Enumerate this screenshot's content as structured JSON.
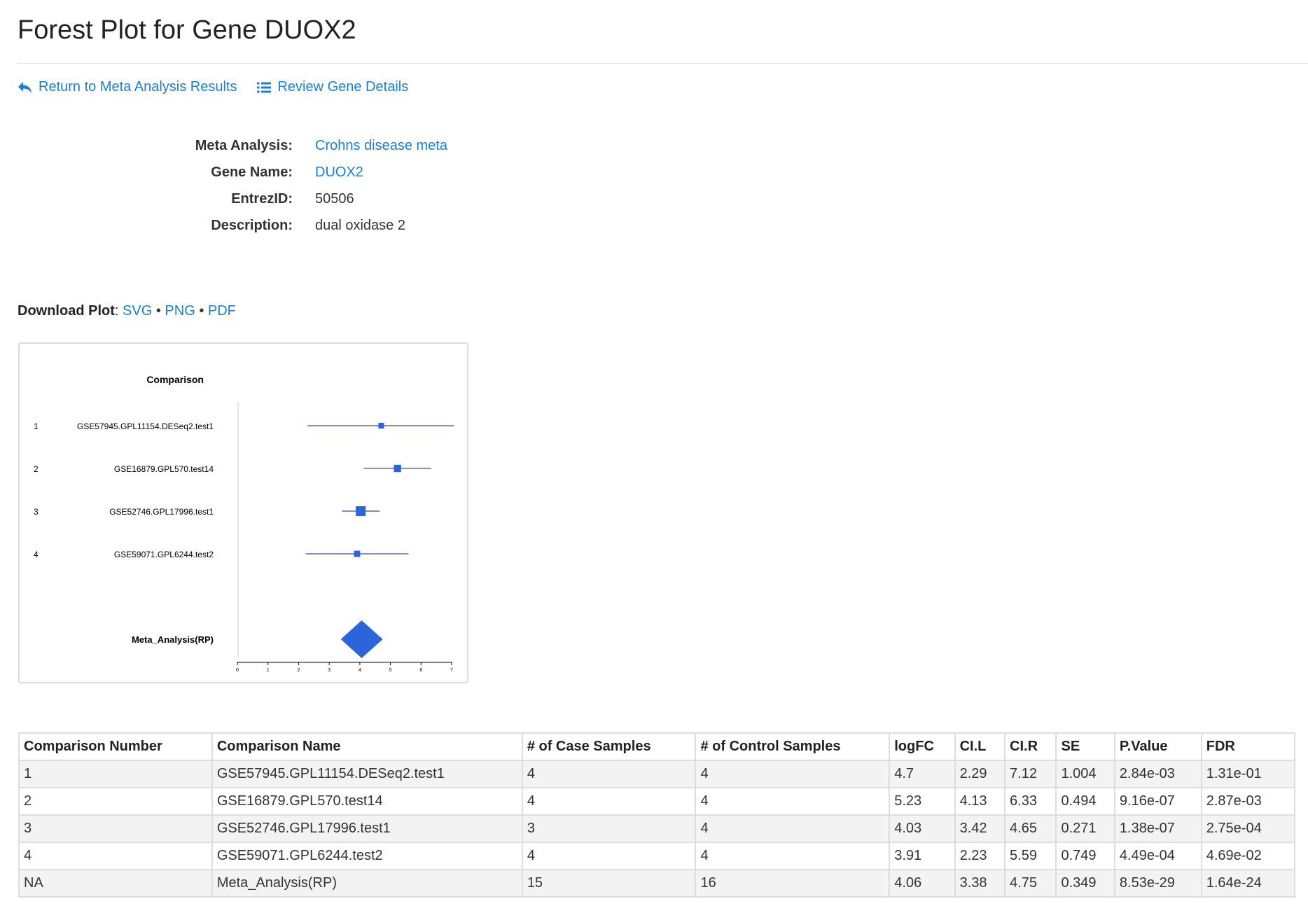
{
  "page": {
    "title": "Forest Plot for Gene DUOX2"
  },
  "nav": {
    "return_label": "Return to Meta Analysis Results",
    "review_label": "Review Gene Details"
  },
  "info": {
    "meta_analysis_label": "Meta Analysis:",
    "meta_analysis_value": "Crohns disease meta",
    "gene_name_label": "Gene Name:",
    "gene_name_value": "DUOX2",
    "entrez_label": "EntrezID:",
    "entrez_value": "50506",
    "description_label": "Description:",
    "description_value": "dual oxidase 2"
  },
  "download": {
    "label": "Download Plot",
    "colon": ":",
    "sep": "•",
    "svg": "SVG",
    "png": "PNG",
    "pdf": "PDF"
  },
  "chart_data": {
    "type": "forest",
    "header": "Comparison",
    "color": "#2b65d9",
    "line_color": "#3a4a9e",
    "xlim": [
      0,
      7
    ],
    "xticks": [
      "0",
      "1",
      "2",
      "3",
      "4",
      "5",
      "6",
      "7"
    ],
    "studies": [
      {
        "num": "1",
        "name": "GSE57945.GPL11154.DESeq2.test1",
        "est": 4.7,
        "lo": 2.29,
        "hi": 7.12,
        "se": 1.004
      },
      {
        "num": "2",
        "name": "GSE16879.GPL570.test14",
        "est": 5.23,
        "lo": 4.13,
        "hi": 6.33,
        "se": 0.494
      },
      {
        "num": "3",
        "name": "GSE52746.GPL17996.test1",
        "est": 4.03,
        "lo": 3.42,
        "hi": 4.65,
        "se": 0.271
      },
      {
        "num": "4",
        "name": "GSE59071.GPL6244.test2",
        "est": 3.91,
        "lo": 2.23,
        "hi": 5.59,
        "se": 0.749
      }
    ],
    "summary": {
      "name": "Meta_Analysis(RP)",
      "est": 4.06,
      "lo": 3.38,
      "hi": 4.75
    }
  },
  "table": {
    "headers": [
      "Comparison Number",
      "Comparison Name",
      "# of Case Samples",
      "# of Control Samples",
      "logFC",
      "CI.L",
      "CI.R",
      "SE",
      "P.Value",
      "FDR"
    ],
    "rows": [
      [
        "1",
        "GSE57945.GPL11154.DESeq2.test1",
        "4",
        "4",
        "4.7",
        "2.29",
        "7.12",
        "1.004",
        "2.84e-03",
        "1.31e-01"
      ],
      [
        "2",
        "GSE16879.GPL570.test14",
        "4",
        "4",
        "5.23",
        "4.13",
        "6.33",
        "0.494",
        "9.16e-07",
        "2.87e-03"
      ],
      [
        "3",
        "GSE52746.GPL17996.test1",
        "3",
        "4",
        "4.03",
        "3.42",
        "4.65",
        "0.271",
        "1.38e-07",
        "2.75e-04"
      ],
      [
        "4",
        "GSE59071.GPL6244.test2",
        "4",
        "4",
        "3.91",
        "2.23",
        "5.59",
        "0.749",
        "4.49e-04",
        "4.69e-02"
      ],
      [
        "NA",
        "Meta_Analysis(RP)",
        "15",
        "16",
        "4.06",
        "3.38",
        "4.75",
        "0.349",
        "8.53e-29",
        "1.64e-24"
      ]
    ]
  }
}
